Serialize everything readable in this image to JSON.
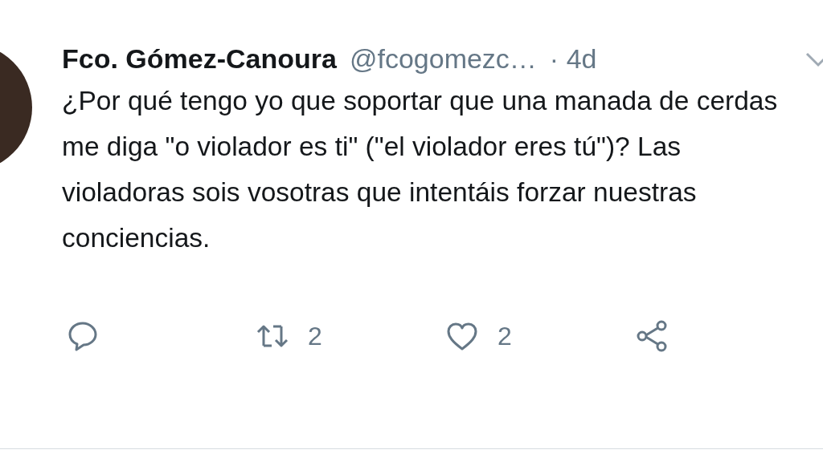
{
  "tweet": {
    "author_name": "Fco. Gómez-Canoura",
    "handle": "@fcogomezc…",
    "time": "· 4d",
    "text": "¿Por qué tengo yo que soportar que una manada de cerdas me diga \"o violador es ti\" (\"el violador eres tú\")? Las violadoras sois vosotras que intentáis forzar nuestras conciencias.",
    "actions": [
      {
        "kind": "reply"
      },
      {
        "kind": "retweet",
        "count": "2"
      },
      {
        "kind": "like",
        "count": "2"
      },
      {
        "kind": "share"
      }
    ]
  }
}
